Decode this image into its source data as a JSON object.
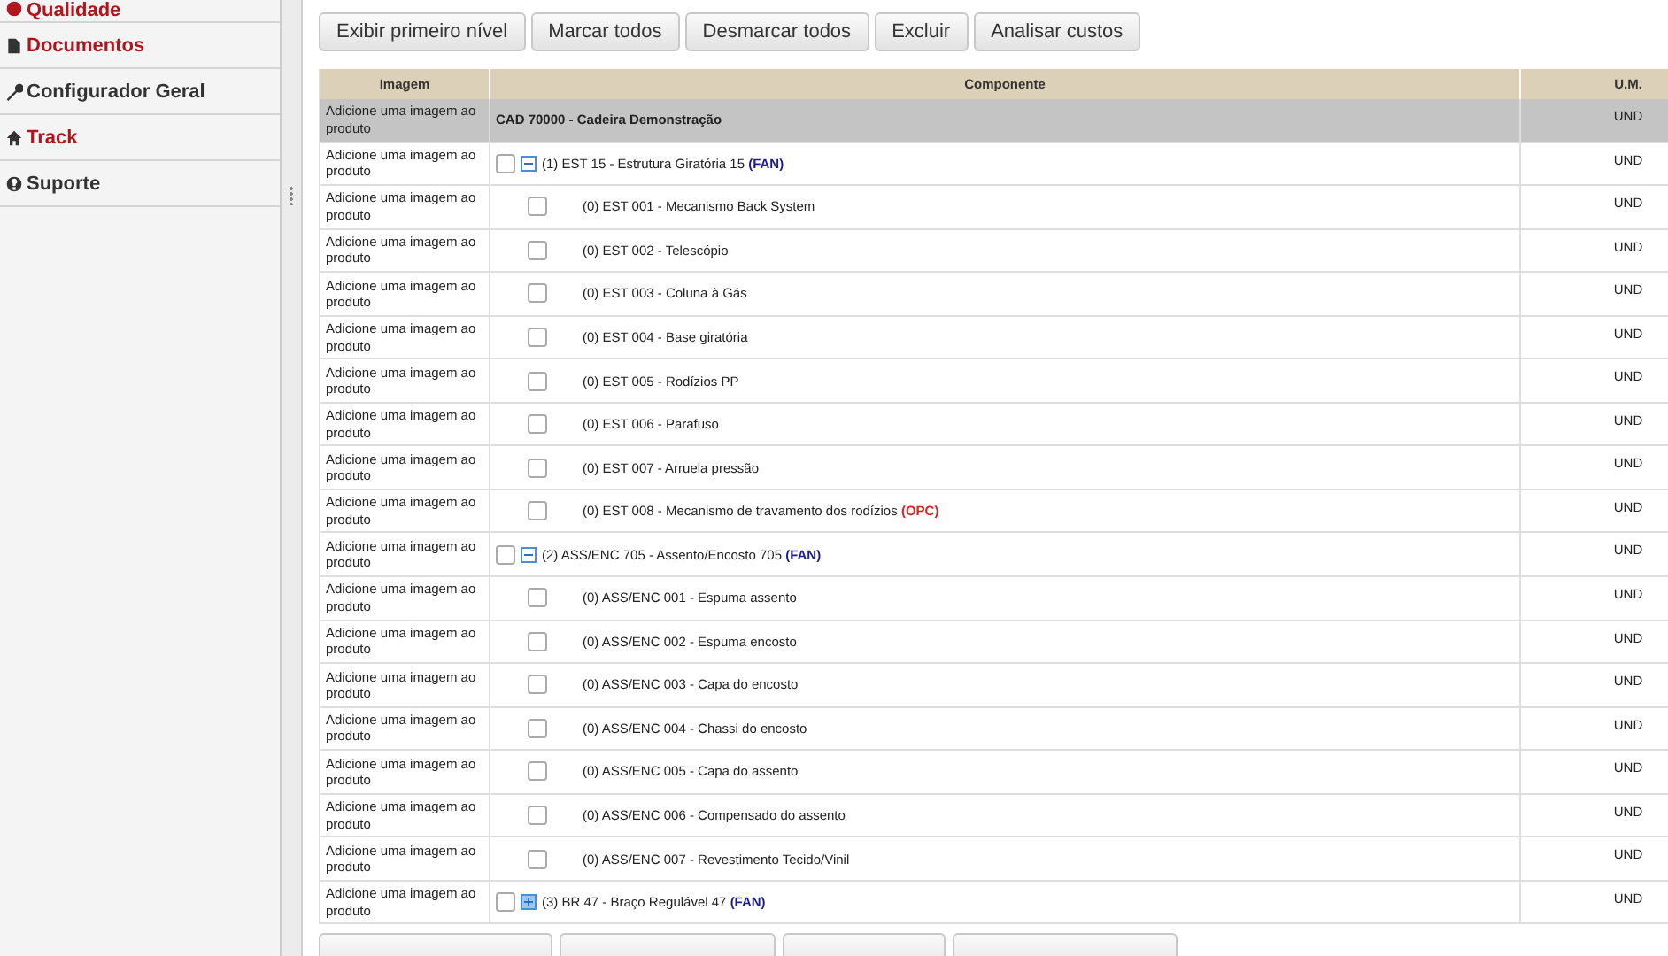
{
  "sidebar": {
    "items": [
      {
        "label": "Qualidade",
        "color": "#b0141c"
      },
      {
        "label": "Documentos",
        "color": "#b0141c"
      },
      {
        "label": "Configurador Geral",
        "color": "#333333"
      },
      {
        "label": "Track",
        "color": "#b0141c"
      },
      {
        "label": "Suporte",
        "color": "#333333"
      }
    ]
  },
  "toolbar": {
    "buttons": [
      "Exibir primeiro nível",
      "Marcar todos",
      "Desmarcar todos",
      "Excluir",
      "Analisar custos"
    ]
  },
  "table": {
    "columns": [
      "Imagem",
      "Componente",
      "U.M."
    ],
    "root": {
      "image": "Adicione uma imagem ao produto",
      "component": "CAD 70000 - Cadeira Demonstração",
      "um": "UND",
      "children": [
        {
          "image": "Adicione uma imagem ao produto",
          "checked": false,
          "expanded": true,
          "component": "(1) EST 15 - Estrutura Giratória 15",
          "tag": {
            "text": "(FAN)",
            "color": "#1c1c8f"
          },
          "um": "UND",
          "children": [
            {
              "image": "Adicione uma imagem ao produto",
              "checked": false,
              "component": "(0) EST 001 - Mecanismo Back System",
              "um": "UND"
            },
            {
              "image": "Adicione uma imagem ao produto",
              "checked": false,
              "component": "(0) EST 002 - Telescópio",
              "um": "UND"
            },
            {
              "image": "Adicione uma imagem ao produto",
              "checked": false,
              "component": "(0) EST 003 - Coluna à Gás",
              "um": "UND"
            },
            {
              "image": "Adicione uma imagem ao produto",
              "checked": false,
              "component": "(0) EST 004 - Base giratória",
              "um": "UND"
            },
            {
              "image": "Adicione uma imagem ao produto",
              "checked": false,
              "component": "(0) EST 005 - Rodízios PP",
              "um": "UND"
            },
            {
              "image": "Adicione uma imagem ao produto",
              "checked": false,
              "component": "(0) EST 006 - Parafuso",
              "um": "UND"
            },
            {
              "image": "Adicione uma imagem ao produto",
              "checked": false,
              "component": "(0) EST 007 - Arruela pressão",
              "um": "UND"
            },
            {
              "image": "Adicione uma imagem ao produto",
              "checked": false,
              "component": "(0) EST 008 - Mecanismo de travamento dos rodízios",
              "tag": {
                "text": "(OPC)",
                "color": "#e02020"
              },
              "um": "UND"
            }
          ]
        },
        {
          "image": "Adicione uma imagem ao produto",
          "checked": false,
          "expanded": true,
          "component": "(2) ASS/ENC 705 - Assento/Encosto 705",
          "tag": {
            "text": "(FAN)",
            "color": "#1c1c8f"
          },
          "um": "UND",
          "children": [
            {
              "image": "Adicione uma imagem ao produto",
              "checked": false,
              "component": "(0) ASS/ENC 001 - Espuma assento",
              "um": "UND"
            },
            {
              "image": "Adicione uma imagem ao produto",
              "checked": false,
              "component": "(0) ASS/ENC 002 - Espuma encosto",
              "um": "UND"
            },
            {
              "image": "Adicione uma imagem ao produto",
              "checked": false,
              "component": "(0) ASS/ENC 003 - Capa do encosto",
              "um": "UND"
            },
            {
              "image": "Adicione uma imagem ao produto",
              "checked": false,
              "component": "(0) ASS/ENC 004 - Chassi do encosto",
              "um": "UND"
            },
            {
              "image": "Adicione uma imagem ao produto",
              "checked": false,
              "component": "(0) ASS/ENC 005 - Capa do assento",
              "um": "UND"
            },
            {
              "image": "Adicione uma imagem ao produto",
              "checked": false,
              "component": "(0) ASS/ENC 006 - Compensado do assento",
              "um": "UND"
            },
            {
              "image": "Adicione uma imagem ao produto",
              "checked": false,
              "component": "(0) ASS/ENC 007 - Revestimento Tecido/Vinil",
              "um": "UND"
            }
          ]
        },
        {
          "image": "Adicione uma imagem ao produto",
          "checked": false,
          "expanded": false,
          "component": "(3) BR 47 - Braço Regulável 47",
          "tag": {
            "text": "(FAN)",
            "color": "#1c1c8f"
          },
          "um": "UND"
        }
      ]
    }
  }
}
